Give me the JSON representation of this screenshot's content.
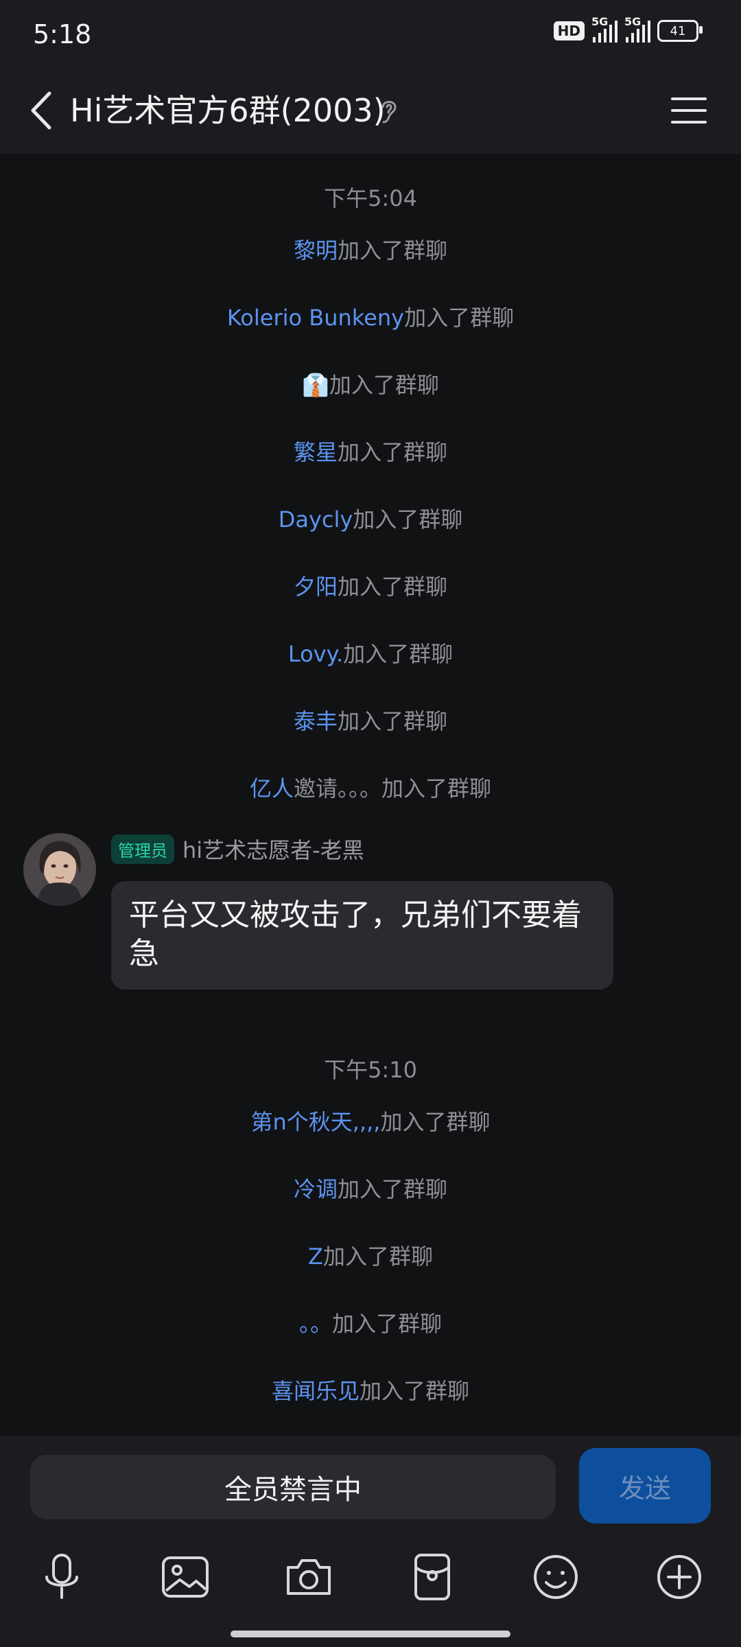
{
  "status": {
    "time": "5:18",
    "hd": "HD",
    "signal1": "5G",
    "signal2": "5G",
    "battery": "41"
  },
  "header": {
    "title": "Hi艺术官方6群(2003)"
  },
  "chat": {
    "time1": "下午5:04",
    "joined_suffix": "加入了群聊",
    "events1": [
      {
        "name": "黎明"
      },
      {
        "name": "Kolerio  Bunkeny"
      },
      {
        "name": "👔"
      },
      {
        "name": "繁星"
      },
      {
        "name": "Daycly"
      },
      {
        "name": "夕阳"
      },
      {
        "name": "Lovy."
      },
      {
        "name": "泰丰"
      }
    ],
    "invite": {
      "inviter": "亿人",
      "text": "邀请。。。"
    },
    "message": {
      "badge": "管理员",
      "sender": "hi艺术志愿者-老黑",
      "text": "平台又又被攻击了，兄弟们不要着急"
    },
    "time2": "下午5:10",
    "events2": [
      {
        "name": "第n个秋天,,,,"
      },
      {
        "name": "冷调"
      },
      {
        "name": "Z"
      },
      {
        "name": "。。"
      },
      {
        "name": "喜闻乐见"
      }
    ]
  },
  "composer": {
    "mute_text": "全员禁言中",
    "send_label": "发送"
  },
  "toolbar": {
    "icons": [
      "microphone-icon",
      "image-icon",
      "camera-icon",
      "red-packet-icon",
      "emoji-icon",
      "plus-icon"
    ]
  }
}
